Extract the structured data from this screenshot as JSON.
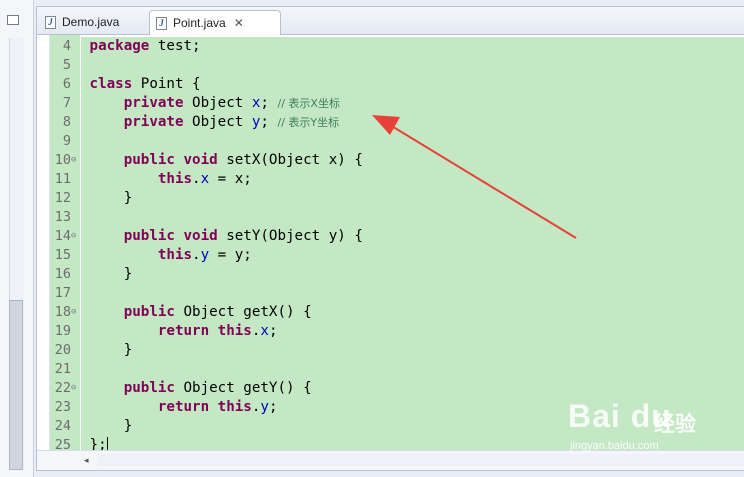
{
  "tabs": [
    {
      "label": "Demo.java",
      "active": false
    },
    {
      "label": "Point.java",
      "active": true
    }
  ],
  "code_lines": [
    {
      "num": "4",
      "fold": "",
      "html": "<span class=\"kw\">package</span> test;"
    },
    {
      "num": "5",
      "fold": "",
      "html": ""
    },
    {
      "num": "6",
      "fold": "",
      "html": "<span class=\"kw\">class</span> Point {"
    },
    {
      "num": "7",
      "fold": "",
      "html": "    <span class=\"kw\">private</span> Object <span class=\"fld\">x</span>; <span class=\"cm\">// 表示X坐标</span>"
    },
    {
      "num": "8",
      "fold": "",
      "html": "    <span class=\"kw\">private</span> Object <span class=\"fld\">y</span>; <span class=\"cm\">// 表示Y坐标</span>"
    },
    {
      "num": "9",
      "fold": "",
      "html": ""
    },
    {
      "num": "10",
      "fold": "⊖",
      "html": "    <span class=\"kw\">public void</span> setX(Object x) {"
    },
    {
      "num": "11",
      "fold": "",
      "html": "        <span class=\"kw\">this</span>.<span class=\"fld\">x</span> = x;"
    },
    {
      "num": "12",
      "fold": "",
      "html": "    }"
    },
    {
      "num": "13",
      "fold": "",
      "html": ""
    },
    {
      "num": "14",
      "fold": "⊖",
      "html": "    <span class=\"kw\">public void</span> setY(Object y) {"
    },
    {
      "num": "15",
      "fold": "",
      "html": "        <span class=\"kw\">this</span>.<span class=\"fld\">y</span> = y;"
    },
    {
      "num": "16",
      "fold": "",
      "html": "    }"
    },
    {
      "num": "17",
      "fold": "",
      "html": ""
    },
    {
      "num": "18",
      "fold": "⊖",
      "html": "    <span class=\"kw\">public</span> Object getX() {"
    },
    {
      "num": "19",
      "fold": "",
      "html": "        <span class=\"kw\">return this</span>.<span class=\"fld\">x</span>;"
    },
    {
      "num": "20",
      "fold": "",
      "html": "    }"
    },
    {
      "num": "21",
      "fold": "",
      "html": ""
    },
    {
      "num": "22",
      "fold": "⊖",
      "html": "    <span class=\"kw\">public</span> Object getY() {"
    },
    {
      "num": "23",
      "fold": "",
      "html": "        <span class=\"kw\">return this</span>.<span class=\"fld\">y</span>;"
    },
    {
      "num": "24",
      "fold": "",
      "html": "    }"
    },
    {
      "num": "25",
      "fold": "",
      "html": "};"
    }
  ],
  "colors": {
    "highlight": "#c4e8c4",
    "keyword": "#7f0055",
    "field": "#0000c0",
    "comment": "#3f7f5f",
    "annotation_arrow": "#e8413a"
  },
  "icons": {
    "tab_file": "java-file-icon",
    "tab_close": "close-icon",
    "fold_marker": "fold-collapse-icon",
    "scroll_left": "scroll-left-arrow-icon",
    "panel_minimize": "minimize-icon"
  },
  "watermark": {
    "logo": "Bai du",
    "brand": "经验",
    "url": "jingyan.baidu.com"
  }
}
